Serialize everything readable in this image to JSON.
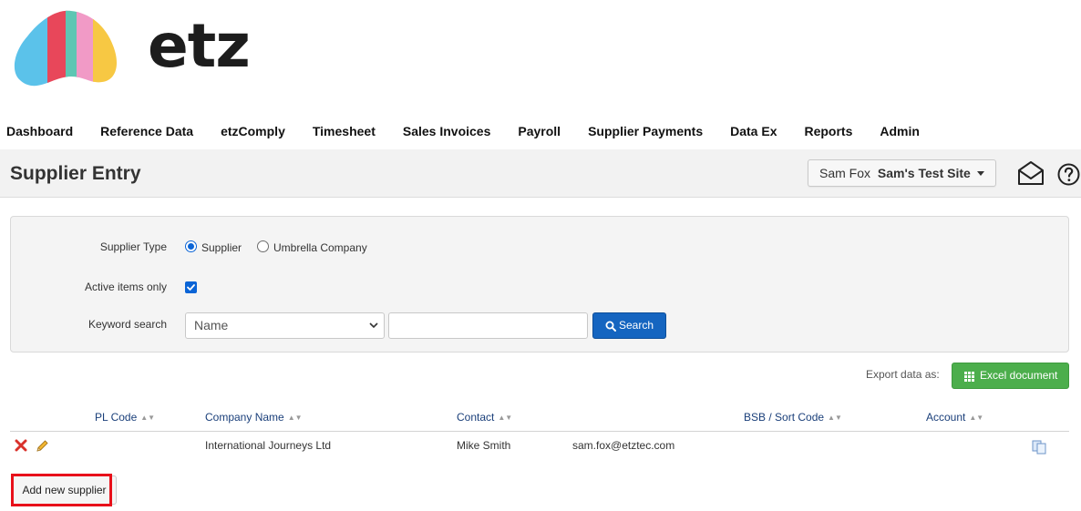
{
  "brand": {
    "name": "etz"
  },
  "nav": [
    "Dashboard",
    "Reference Data",
    "etzComply",
    "Timesheet",
    "Sales Invoices",
    "Payroll",
    "Supplier Payments",
    "Data Ex",
    "Reports",
    "Admin"
  ],
  "page": {
    "title": "Supplier Entry"
  },
  "site_selector": {
    "user": "Sam Fox",
    "site": "Sam's Test Site"
  },
  "filters": {
    "supplier_type_label": "Supplier Type",
    "supplier_type_options": [
      "Supplier",
      "Umbrella Company"
    ],
    "supplier_type_selected": "Supplier",
    "active_label": "Active items only",
    "active_checked": true,
    "keyword_label": "Keyword search",
    "keyword_field": "Name",
    "keyword_value": "",
    "search_label": "Search"
  },
  "export": {
    "label": "Export data as:",
    "button": "Excel document"
  },
  "table": {
    "columns": [
      "PL Code",
      "Company Name",
      "Contact",
      "BSB / Sort Code",
      "Account"
    ],
    "rows": [
      {
        "pl_code": "",
        "company_name": "International Journeys Ltd",
        "contact": "Mike Smith",
        "email": "sam.fox@etztec.com",
        "bsb": "",
        "account": ""
      }
    ]
  },
  "add_button": "Add new supplier",
  "colors": {
    "primary": "#1565c0",
    "excel": "#4cae4c",
    "highlight": "#e8101a",
    "logo": [
      "#5bc2ea",
      "#e8475a",
      "#5ec6b3",
      "#f19ac6",
      "#f7c843"
    ]
  }
}
